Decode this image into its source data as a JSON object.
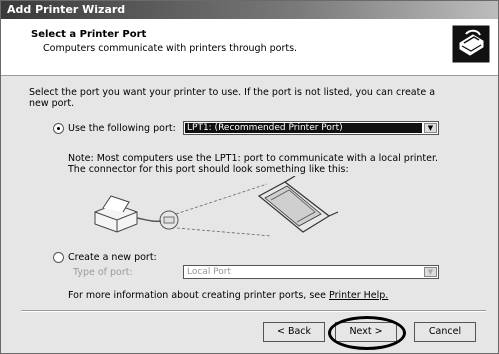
{
  "window": {
    "title": "Add Printer Wizard"
  },
  "header": {
    "title": "Select a Printer Port",
    "subtitle": "Computers communicate with printers through ports.",
    "icon": "printer-wizard-icon"
  },
  "instruction": {
    "line1": "Select the port you want your printer to use. If the port is not listed, you can create a",
    "line2": "new port."
  },
  "use_port": {
    "label": "Use the following port:",
    "selected": true,
    "value": "LPT1: (Recommended Printer Port)"
  },
  "note": {
    "line1": "Note: Most computers use the LPT1: port to communicate with a local printer.",
    "line2": "The connector for this port should look something like this:"
  },
  "illustration": {
    "icon": "printer-parallel-cable-illustration"
  },
  "create_port": {
    "label": "Create a new port:",
    "selected": false,
    "type_label": "Type of port:",
    "type_value": "Local Port"
  },
  "more_info": {
    "text": "For more information about creating printer ports, see",
    "link": "Printer Help."
  },
  "buttons": {
    "back": "< Back",
    "next": "Next >",
    "cancel": "Cancel"
  }
}
